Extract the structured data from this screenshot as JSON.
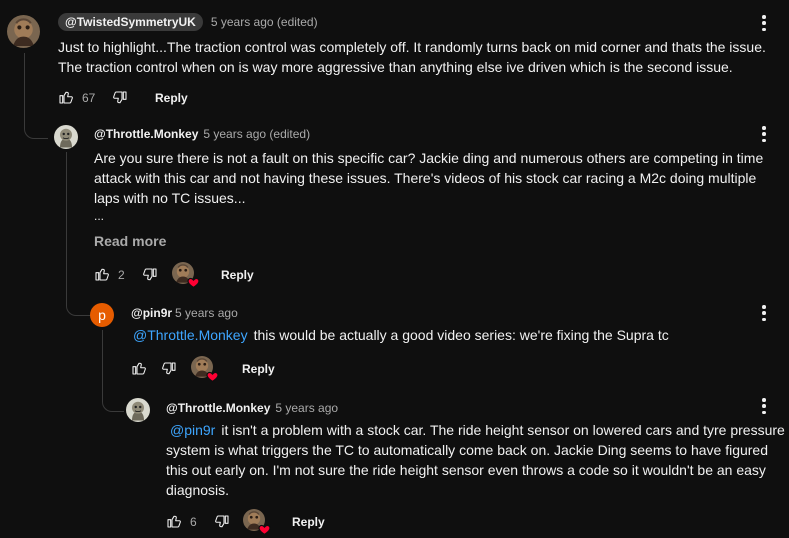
{
  "comments": [
    {
      "handle": "@TwistedSymmetryUK",
      "meta": "5 years ago (edited)",
      "lines": [
        "Just to highlight...The traction control was completely off. It randomly turns back on mid corner and thats the issue.",
        "The traction control when on is way more aggressive than anything else ive driven which is the second issue."
      ],
      "likes": "67",
      "reply_label": "Reply"
    },
    {
      "handle": "@Throttle.Monkey",
      "meta": "5 years ago (edited)",
      "lines": [
        "Are you sure there is not a fault on this specific car? Jackie ding and numerous others are competing in time",
        "attack with this car and not having these issues. There's videos of his stock car racing a M2c doing multiple",
        "laps with no TC issues..."
      ],
      "ellipsis": "...",
      "read_more": "Read more",
      "likes": "2",
      "reply_label": "Reply"
    },
    {
      "avatar_letter": "p",
      "handle": "@pin9r",
      "meta": "5 years ago",
      "mention": "@Throttle.Monkey",
      "text": "this would be actually a good video series: we're fixing the Supra tc",
      "reply_label": "Reply"
    },
    {
      "handle": "@Throttle.Monkey",
      "meta": "5 years ago",
      "mention": "@pin9r",
      "first_line": "it isn't a problem with a stock car. The ride height sensor on lowered cars and tyre pressure",
      "lines": [
        "system is what triggers the TC to automatically come back on. Jackie Ding seems to have figured",
        "this out early on. I'm not sure the ride height sensor even throws a code so it wouldn't be an easy",
        "diagnosis."
      ],
      "likes": "6",
      "reply_label": "Reply"
    }
  ],
  "icons": {
    "like": "thumb-up-icon",
    "dislike": "thumb-down-icon",
    "more": "more-vert-icon",
    "creator_heart": "heart-icon"
  },
  "colors": {
    "background": "#0f0f0f",
    "text": "#f1f1f1",
    "secondary": "#aaaaaa",
    "link": "#3ea6ff",
    "heart": "#ff0033",
    "letter_avatar": "#e65c00"
  }
}
